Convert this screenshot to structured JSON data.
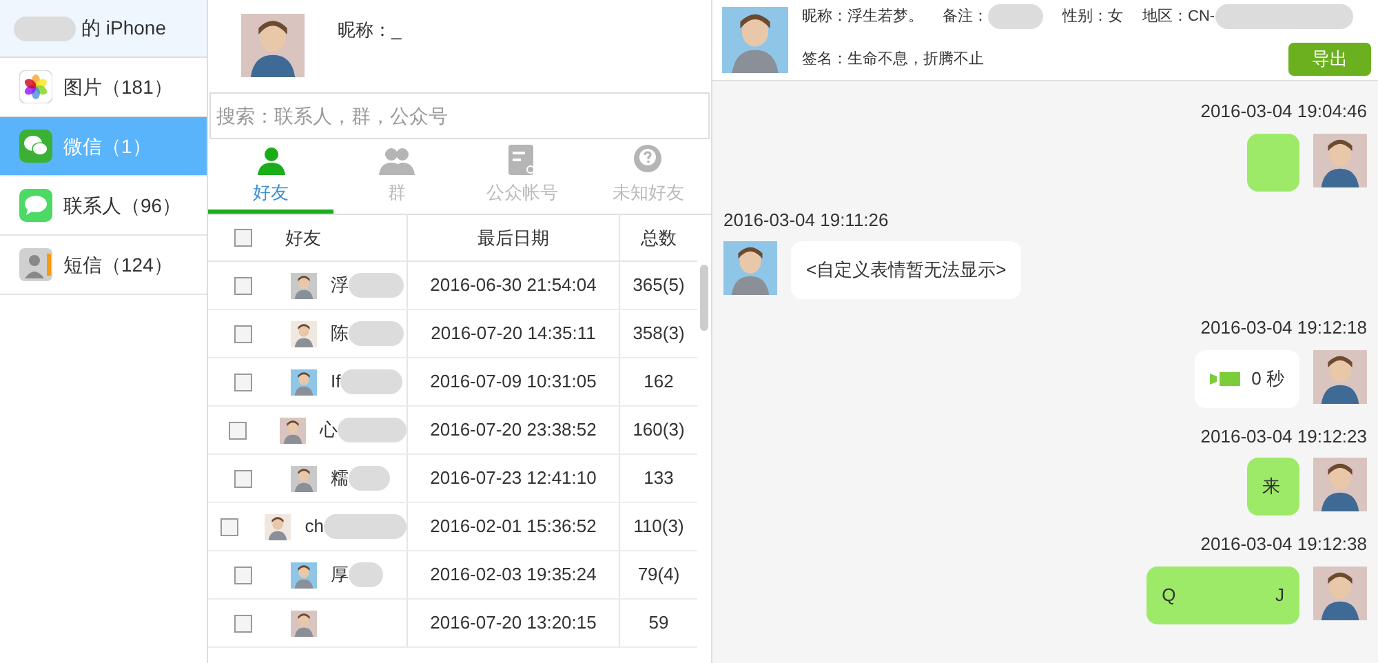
{
  "device": {
    "name": "的 iPhone"
  },
  "sidebar": {
    "items": [
      {
        "label": "图片（181）",
        "kind": "photos",
        "selected": false
      },
      {
        "label": "微信（1）",
        "kind": "wechat",
        "selected": true
      },
      {
        "label": "联系人（96）",
        "kind": "messages",
        "selected": false
      },
      {
        "label": "短信（124）",
        "kind": "contacts",
        "selected": false
      }
    ]
  },
  "profile": {
    "nickname": "昵称：_"
  },
  "search": {
    "placeholder": "搜索：联系人，群，公众号"
  },
  "tabs": [
    {
      "label": "好友",
      "kind": "friend",
      "selected": true
    },
    {
      "label": "群",
      "kind": "group",
      "selected": false
    },
    {
      "label": "公众帐号",
      "kind": "official",
      "selected": false
    },
    {
      "label": "未知好友",
      "kind": "unknown",
      "selected": false
    }
  ],
  "table": {
    "select_all_checked": false,
    "columns": [
      "好友",
      "最后日期",
      "总数"
    ],
    "rows": [
      {
        "checked": false,
        "name": "浮",
        "date": "2016-06-30 21:54:04",
        "total": "365(5)"
      },
      {
        "checked": false,
        "name": "陈",
        "date": "2016-07-20 14:35:11",
        "total": "358(3)"
      },
      {
        "checked": false,
        "name": "If",
        "date": "2016-07-09 10:31:05",
        "total": "162"
      },
      {
        "checked": false,
        "name": "心",
        "date": "2016-07-20 23:38:52",
        "total": "160(3)"
      },
      {
        "checked": false,
        "name": "糯",
        "date": "2016-07-23 12:41:10",
        "total": "133"
      },
      {
        "checked": false,
        "name": "ch",
        "date": "2016-02-01 15:36:52",
        "total": "110(3)"
      },
      {
        "checked": false,
        "name": "厚",
        "date": "2016-02-03 19:35:24",
        "total": "79(4)"
      },
      {
        "checked": false,
        "date": "2016-07-20 13:20:15",
        "total": "59"
      }
    ]
  },
  "contact": {
    "nickname": "昵称：浮生若梦。",
    "remark": "备注：",
    "gender": "性别：女",
    "region": "地区：CN-",
    "signature": "签名：生命不息，折腾不止",
    "export_button": "导出"
  },
  "messages": [
    {
      "time": "2016-03-04 19:04:46",
      "outgoing": true,
      "kind": "blank"
    },
    {
      "time": "2016-03-04 19:11:26",
      "outgoing": false,
      "kind": "text",
      "text": "<自定义表情暂无法显示>"
    },
    {
      "time": "2016-03-04 19:12:18",
      "outgoing": true,
      "kind": "voice",
      "text": "0 秒"
    },
    {
      "time": "2016-03-04 19:12:23",
      "outgoing": true,
      "kind": "text",
      "text": "来"
    },
    {
      "time": "2016-03-04 19:12:38",
      "outgoing": true,
      "kind": "text",
      "text": "Q                    J"
    }
  ]
}
